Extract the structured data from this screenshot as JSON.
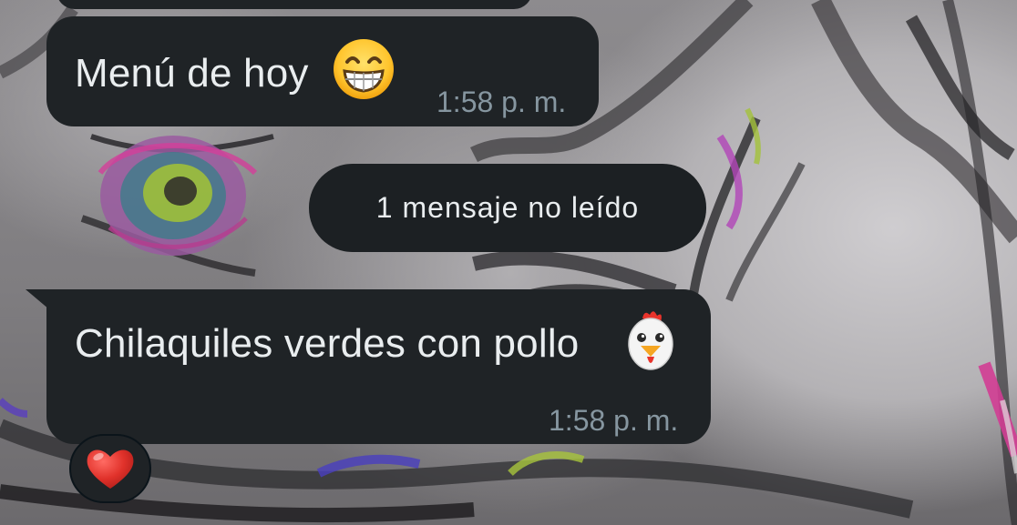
{
  "messages": [
    {
      "text": "Menú de hoy",
      "emoji": "grinning-face-icon",
      "time": "1:58 p. m."
    },
    {
      "text": "Chilaquiles verdes con pollo",
      "emoji": "chicken-icon",
      "time": "1:58 p. m.",
      "reaction": "red-heart-icon"
    }
  ],
  "unread_banner": "1 mensaje no leído",
  "colors": {
    "bubble": "#1f2326",
    "text": "#e9edef",
    "timestamp": "#8696a0",
    "heart": "#e0312a"
  }
}
